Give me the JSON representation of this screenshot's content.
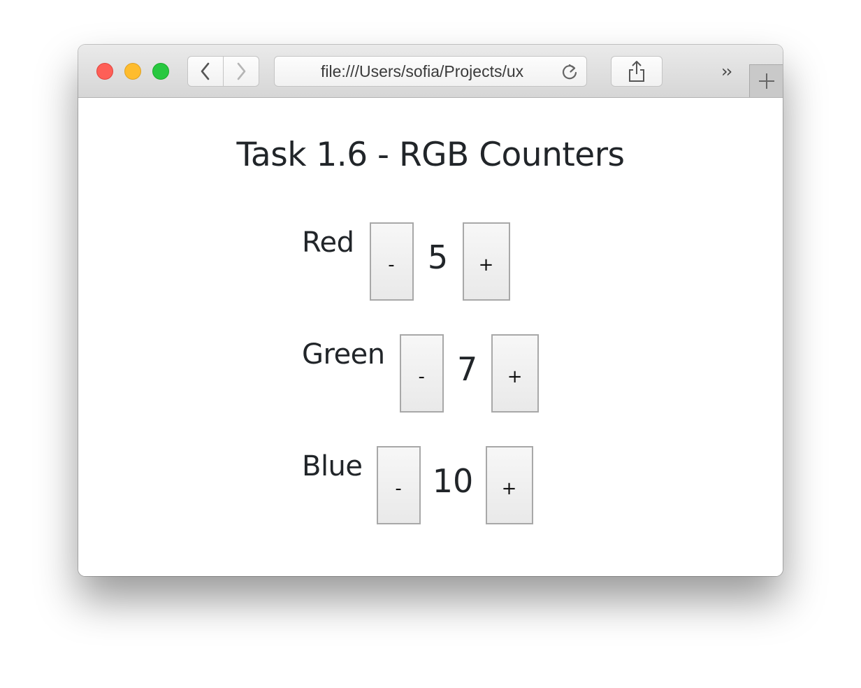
{
  "browser": {
    "url": "file:///Users/sofia/Projects/ux",
    "icons": {
      "back": "chevron-left-icon",
      "forward": "chevron-right-icon",
      "reload": "reload-icon",
      "share": "share-icon",
      "overflow": "overflow-icon",
      "new_tab": "plus-icon"
    },
    "overflow_glyph": "››",
    "traffic_colors": {
      "close": "#fe5f57",
      "minimize": "#febc2e",
      "maximize": "#28c840"
    }
  },
  "page": {
    "heading": "Task 1.6 - RGB Counters",
    "counters": [
      {
        "label": "Red",
        "value": "5",
        "decrement_label": "-",
        "increment_label": "+"
      },
      {
        "label": "Green",
        "value": "7",
        "decrement_label": "-",
        "increment_label": "+"
      },
      {
        "label": "Blue",
        "value": "10",
        "decrement_label": "-",
        "increment_label": "+"
      }
    ]
  }
}
